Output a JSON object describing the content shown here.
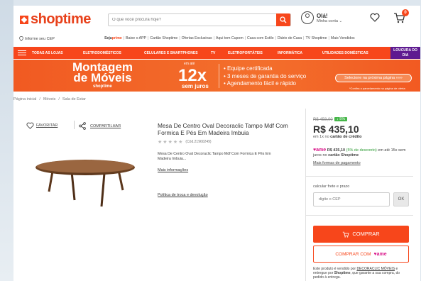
{
  "header": {
    "logo": "shoptime",
    "search_placeholder": "O que você procura hoje?",
    "greeting": "Olá!",
    "account_label": "Minha conta",
    "cart_count": "0"
  },
  "subheader": {
    "cep_label": "Informe seu CEP",
    "links": [
      "Seja",
      "prime",
      "Baixe o APP",
      "Cartão Shoptime",
      "Ofertas Exclusivas",
      "Aqui tem Cupom",
      "Casa com Estilo",
      "Diário de Casa",
      "TV Shoptime",
      "Mais Vendidos"
    ]
  },
  "nav": {
    "items": [
      "Todas as lojas",
      "Eletrodomésticos",
      "Celulares e Smartphones",
      "TV",
      "Eletroportáteis",
      "Informática",
      "Utilidades Domésticas"
    ],
    "loucura": "LOUCURA DO DIA"
  },
  "banner": {
    "title_line1": "Montagem",
    "title_line2": "de Móveis",
    "sub": "shoptime",
    "small": "em até",
    "big": "12x",
    "juros": "sem juros",
    "features": [
      "• Equipe certificada",
      "• 3 meses de garantia do serviço",
      "• Agendamento fácil e rápido"
    ],
    "cta": "Selecione na próxima página »»»",
    "note": "*Confira o parcelamento na página de oferta"
  },
  "breadcrumb": [
    "Página inicial",
    "/",
    "Móveis",
    "/",
    "Sala de Estar"
  ],
  "product": {
    "favorite": "FAVORITAR",
    "share": "COMPARTILHAR",
    "title": "Mesa De Centro Oval Decoraclic Tampo Mdf Com Formica E Pés Em Madeira Imbuia",
    "code": "(Cód.21960249)",
    "description": "Mesa De Centro Oval Decoraclic Tampo Mdf Com Formica E Pés Em Madeira Imbuia...",
    "more_info": "Mais informações",
    "policy": "Política de troca e devolução"
  },
  "buybox": {
    "old_price": "R$ 458,00",
    "discount": "↓ 5%",
    "price": "R$ 435,10",
    "price_note_prefix": "em 1x no",
    "price_note_bold": "cartão de crédito",
    "ame_price": "R$ 435,10",
    "ame_pct": "(5% de desconto)",
    "ame_rest": "em até 15x sem juros no",
    "ame_card": "cartão Shoptime",
    "payment": "Mais formas de pagamento",
    "frete_label": "calcular frete e prazo",
    "cep_placeholder": "digite o CEP",
    "ok": "OK",
    "buy": "COMPRAR",
    "buy_with": "COMPRAR COM",
    "ame": "ame",
    "seller_prefix": "Este produto é vendido por",
    "seller_name": "DECORACLIC MÓVEIS",
    "seller_mid": "e entregue por",
    "seller_delivery": "Shoptime",
    "seller_suffix": ", que garante a sua compra, do pedido à entrega."
  },
  "colors": {
    "brand": "#f7461b",
    "loucura": "#5e1a90",
    "ame": "#d9178a",
    "discount": "#45b649"
  }
}
